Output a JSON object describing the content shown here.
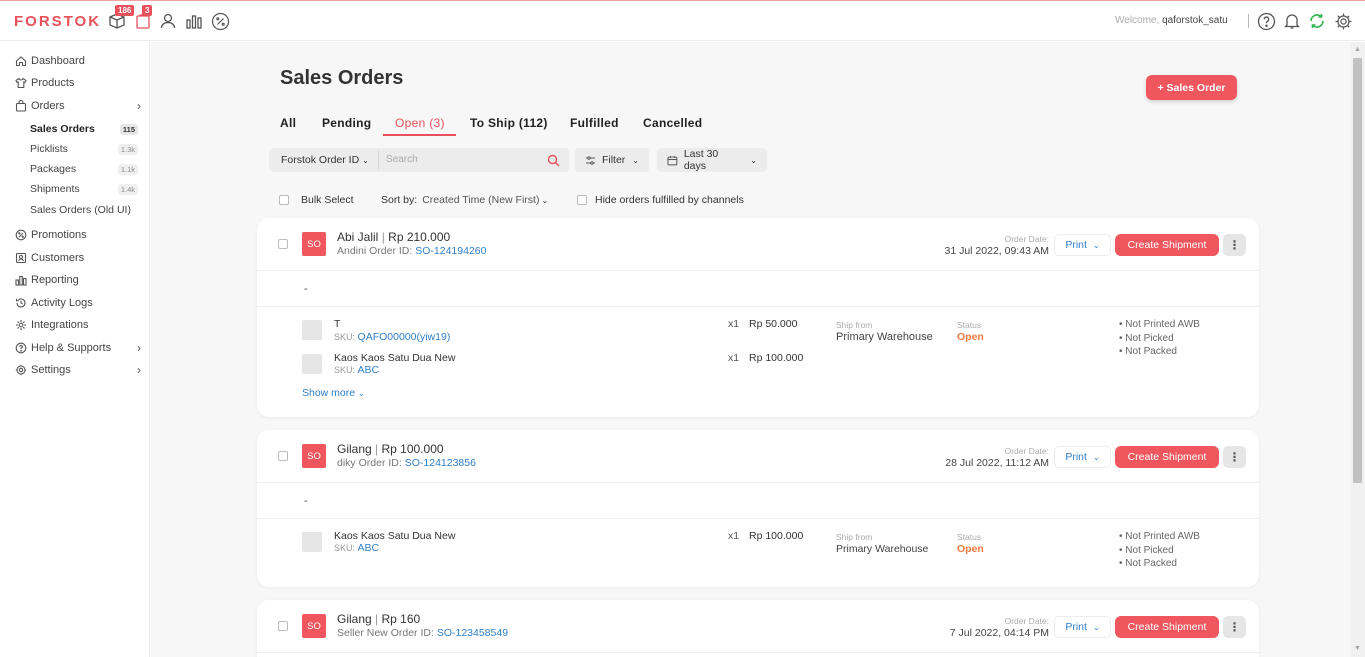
{
  "brand": {
    "logo_text": "FORSTOK",
    "accent": "#e8505b"
  },
  "topbar": {
    "badges": {
      "box": "186",
      "store": "3"
    },
    "welcome_prefix": "Welcome,",
    "username": "qaforstok_satu",
    "icons": [
      "box-icon",
      "store-icon",
      "user-icon",
      "chart-icon",
      "percent-icon",
      "help-icon",
      "bell-icon",
      "sync-icon",
      "gear-icon"
    ]
  },
  "sidebar": {
    "items": [
      {
        "label": "Dashboard",
        "icon": "home-icon"
      },
      {
        "label": "Products",
        "icon": "shirt-icon"
      },
      {
        "label": "Orders",
        "icon": "bag-icon"
      },
      {
        "label": "Promotions",
        "icon": "promo-icon"
      },
      {
        "label": "Customers",
        "icon": "customers-icon"
      },
      {
        "label": "Reporting",
        "icon": "chart-icon"
      },
      {
        "label": "Activity Logs",
        "icon": "history-icon"
      },
      {
        "label": "Integrations",
        "icon": "integrations-icon"
      },
      {
        "label": "Help & Supports",
        "icon": "help-icon"
      },
      {
        "label": "Settings",
        "icon": "gear-icon"
      }
    ],
    "orders_sub": [
      {
        "label": "Sales Orders",
        "count": "115"
      },
      {
        "label": "Picklists",
        "count": "1.3k"
      },
      {
        "label": "Packages",
        "count": "1.1k"
      },
      {
        "label": "Shipments",
        "count": "1.4k"
      },
      {
        "label": "Sales Orders (Old UI)",
        "count": ""
      }
    ]
  },
  "main": {
    "title": "Sales Orders",
    "add_button": "+ Sales Order",
    "tabs": [
      "All",
      "Pending",
      "Open (3)",
      "To Ship (112)",
      "Fulfilled",
      "Cancelled"
    ],
    "active_tab": "Open (3)",
    "search": {
      "field": "Forstok Order ID",
      "placeholder": "Search"
    },
    "filter_label": "Filter",
    "date_label": "Last 30 days",
    "bulk_select": "Bulk Select",
    "sort_prefix": "Sort by:",
    "sort_value": "Created Time (New First)",
    "hide_label": "Hide orders fulfilled by channels"
  },
  "labels": {
    "order_date": "Order Date:",
    "order_id": "Order ID:",
    "print": "Print",
    "create_shipment": "Create Shipment",
    "ship_from": "Ship from",
    "status": "Status",
    "sku": "SKU:",
    "show_more": "Show more",
    "dash": "-"
  },
  "orders": [
    {
      "tag": "SO",
      "customer": "Abi Jalil",
      "amount": "Rp 210.000",
      "channel": "Andini",
      "order_id": "SO-124194260",
      "date": "31 Jul 2022, 09:43 AM",
      "items": [
        {
          "name": "T",
          "sku": "QAFO00000(yiw19)",
          "qty": "x1",
          "price": "Rp 50.000"
        },
        {
          "name": "Kaos Kaos Satu Dua New",
          "sku": "ABC",
          "qty": "x1",
          "price": "Rp 100.000"
        }
      ],
      "warehouse": "Primary Warehouse",
      "status": "Open",
      "flags": [
        "• Not Printed AWB",
        "• Not Picked",
        "• Not Packed"
      ]
    },
    {
      "tag": "SO",
      "customer": "Gilang",
      "amount": "Rp 100.000",
      "channel": "diky",
      "order_id": "SO-124123856",
      "date": "28 Jul 2022, 11:12 AM",
      "items": [
        {
          "name": "Kaos Kaos Satu Dua New",
          "sku": "ABC",
          "qty": "x1",
          "price": "Rp 100.000"
        }
      ],
      "warehouse": "Primary Warehouse",
      "status": "Open",
      "flags": [
        "• Not Printed AWB",
        "• Not Picked",
        "• Not Packed"
      ]
    },
    {
      "tag": "SO",
      "customer": "Gilang",
      "amount": "Rp 160",
      "channel": "Seller New",
      "order_id": "SO-123458549",
      "date": "7 Jul 2022, 04:14 PM"
    }
  ]
}
